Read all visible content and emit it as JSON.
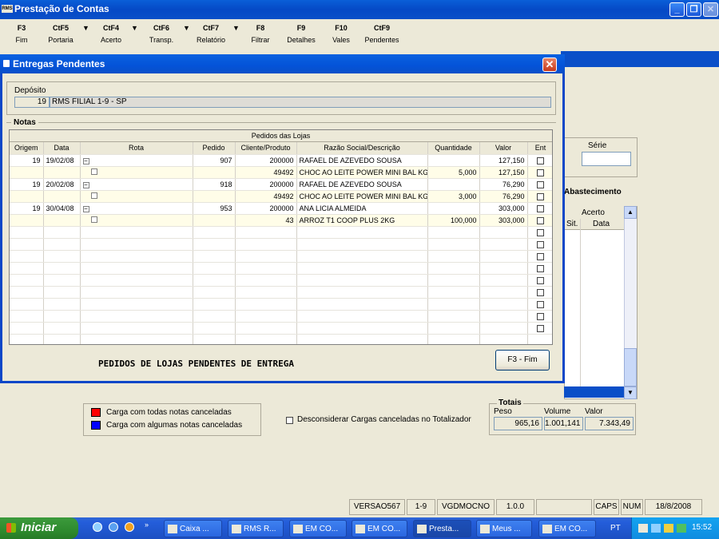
{
  "window": {
    "title": "Prestação de Contas",
    "app_badge": "RMS"
  },
  "toolbar": [
    {
      "key": "F3",
      "label": "Fim"
    },
    {
      "key": "CtF5",
      "label": "Portaria"
    },
    {
      "key": "CtF4",
      "label": "Acerto"
    },
    {
      "key": "CtF6",
      "label": "Transp."
    },
    {
      "key": "CtF7",
      "label": "Relatório"
    },
    {
      "key": "F8",
      "label": "Filtrar"
    },
    {
      "key": "F9",
      "label": "Detalhes"
    },
    {
      "key": "F10",
      "label": "Vales"
    },
    {
      "key": "CtF9",
      "label": "Pendentes"
    }
  ],
  "background": {
    "serie_label": "Série",
    "abastecimento_label": "Abastecimento",
    "acerto_header": "Acerto",
    "sit_header": "Sit.",
    "data_header": "Data",
    "legend": {
      "red_label": "Carga com todas notas canceladas",
      "blue_label": "Carga com algumas notas canceladas",
      "red_color": "#ff0000",
      "blue_color": "#0000ff"
    },
    "checkbox_label": "Desconsiderar Cargas canceladas no Totalizador",
    "totais": {
      "title": "Totais",
      "peso_label": "Peso",
      "volume_label": "Volume",
      "valor_label": "Valor",
      "peso": "965,16",
      "volume": "1.001,141",
      "valor": "7.343,49"
    }
  },
  "dialog": {
    "title": "Entregas Pendentes",
    "deposito_label": "Depósito",
    "deposito_code": "19",
    "deposito_name": "RMS FILIAL 1-9 - SP",
    "notas_label": "Notas",
    "grid_caption": "Pedidos das Lojas",
    "columns": [
      "Origem",
      "Data",
      "Rota",
      "Pedido",
      "Cliente/Produto",
      "Razão Social/Descrição",
      "Quantidade",
      "Valor",
      "Ent"
    ],
    "rows": [
      {
        "origem": "19",
        "data": "19/02/08",
        "tree": "−",
        "pedido": "907",
        "cliente": "200000",
        "razao": "RAFAEL DE AZEVEDO SOUSA",
        "quantidade": "",
        "valor": "127,150"
      },
      {
        "sub": true,
        "cliente": "49492",
        "razao": "CHOC AO LEITE POWER MINI BAL KG",
        "quantidade": "5,000",
        "valor": "127,150"
      },
      {
        "origem": "19",
        "data": "20/02/08",
        "tree": "−",
        "pedido": "918",
        "cliente": "200000",
        "razao": "RAFAEL DE AZEVEDO SOUSA",
        "quantidade": "",
        "valor": "76,290"
      },
      {
        "sub": true,
        "cliente": "49492",
        "razao": "CHOC AO LEITE POWER MINI BAL KG",
        "quantidade": "3,000",
        "valor": "76,290"
      },
      {
        "origem": "19",
        "data": "30/04/08",
        "tree": "−",
        "pedido": "953",
        "cliente": "200000",
        "razao": "ANA LICIA ALMEIDA",
        "quantidade": "",
        "valor": "303,000"
      },
      {
        "sub": true,
        "cliente": "43",
        "razao": "ARROZ T1 COOP PLUS 2KG",
        "quantidade": "100,000",
        "valor": "303,000"
      }
    ],
    "footer_text": "PEDIDOS DE LOJAS PENDENTES DE ENTREGA",
    "fim_button": "F3 - Fim"
  },
  "statusbar": [
    "VERSAO567",
    "1-9",
    "VGDMOCNO",
    "1.0.0",
    "CAPS",
    "NUM",
    "18/8/2008"
  ],
  "taskbar": {
    "start_label": "Iniciar",
    "tasks": [
      "Caixa ...",
      "RMS R...",
      "EM CO...",
      "EM CO...",
      "Presta...",
      "Meus ...",
      "EM CO..."
    ],
    "lang": "PT",
    "clock": "15:52"
  }
}
